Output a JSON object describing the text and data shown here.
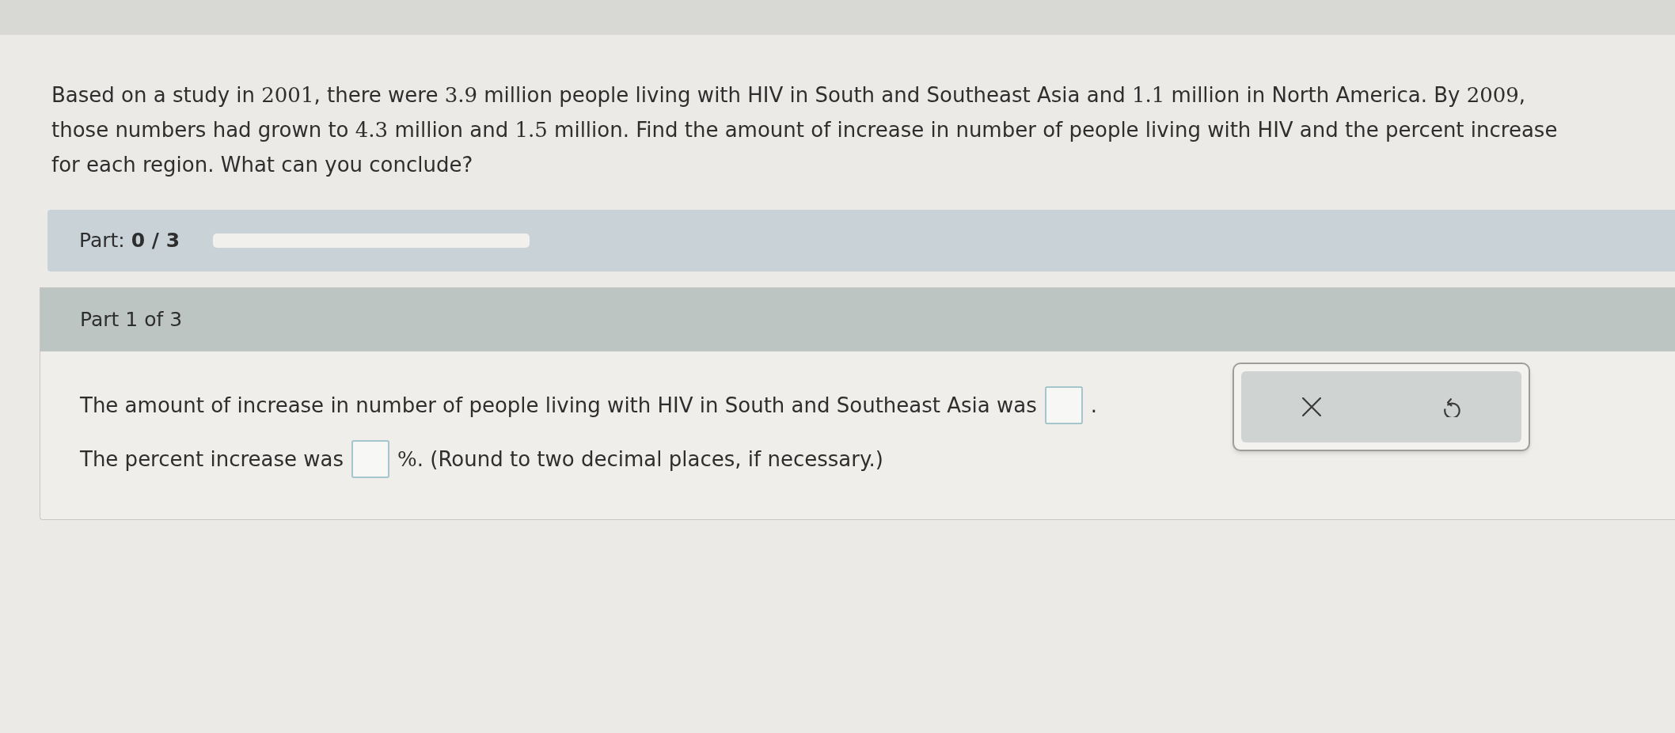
{
  "question": [
    {
      "kind": "text",
      "text": "Based on a study in "
    },
    {
      "kind": "math",
      "text": "2001"
    },
    {
      "kind": "text",
      "text": ", there were "
    },
    {
      "kind": "math",
      "text": "3.9"
    },
    {
      "kind": "text",
      "text": " million people living with HIV in South and Southeast Asia and "
    },
    {
      "kind": "math",
      "text": "1.1"
    },
    {
      "kind": "text",
      "text": " million in North America. By "
    },
    {
      "kind": "math",
      "text": "2009"
    },
    {
      "kind": "text",
      "text": ", those numbers had grown to "
    },
    {
      "kind": "math",
      "text": "4.3"
    },
    {
      "kind": "text",
      "text": " million and "
    },
    {
      "kind": "math",
      "text": "1.5"
    },
    {
      "kind": "text",
      "text": " million. Find the amount of increase in number of people living with HIV and the percent increase for each region. What can you conclude?"
    }
  ],
  "progress": {
    "label": "Part: **0 / 3**"
  },
  "part": {
    "title": "Part 1 of 3",
    "lines": [
      [
        {
          "kind": "text",
          "parts": [
            {
              "kind": "text",
              "text": "The amount of increase in number of people living with HIV in South and Southeast Asia was"
            }
          ]
        },
        {
          "kind": "answer_box"
        },
        {
          "kind": "text",
          "parts": [
            {
              "kind": "text",
              "text": "."
            }
          ]
        }
      ],
      [
        {
          "kind": "text",
          "parts": [
            {
              "kind": "text",
              "text": "The percent increase was"
            }
          ]
        },
        {
          "kind": "answer_box"
        },
        {
          "kind": "text",
          "parts": [
            {
              "kind": "math",
              "text": "%"
            },
            {
              "kind": "text",
              "text": ". (Round to two decimal places, if necessary.)"
            }
          ]
        }
      ]
    ]
  },
  "tools": [
    {
      "kind": "clear"
    },
    {
      "kind": "undo"
    }
  ]
}
